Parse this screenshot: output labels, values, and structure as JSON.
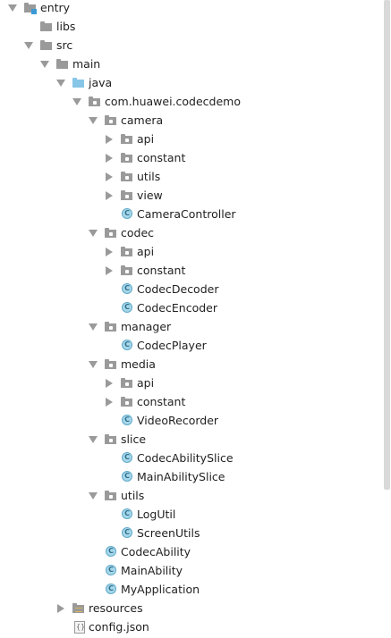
{
  "tree": {
    "entry": "entry",
    "libs": "libs",
    "src": "src",
    "main": "main",
    "java": "java",
    "package": "com.huawei.codecdemo",
    "camera": "camera",
    "camera_api": "api",
    "camera_constant": "constant",
    "camera_utils": "utils",
    "camera_view": "view",
    "camera_controller": "CameraController",
    "codec": "codec",
    "codec_api": "api",
    "codec_constant": "constant",
    "codec_decoder": "CodecDecoder",
    "codec_encoder": "CodecEncoder",
    "manager": "manager",
    "codec_player": "CodecPlayer",
    "media": "media",
    "media_api": "api",
    "media_constant": "constant",
    "video_recorder": "VideoRecorder",
    "slice": "slice",
    "codec_ability_slice": "CodecAbilitySlice",
    "main_ability_slice": "MainAbilitySlice",
    "utils": "utils",
    "log_util": "LogUtil",
    "screen_utils": "ScreenUtils",
    "codec_ability": "CodecAbility",
    "main_ability": "MainAbility",
    "my_application": "MyApplication",
    "resources": "resources",
    "config_json": "config.json"
  },
  "icons": {
    "folder_color": "#9a9a9a",
    "source_folder_color": "#87c6e6",
    "class_fill": "#a7d7ea",
    "class_letter": "C"
  }
}
